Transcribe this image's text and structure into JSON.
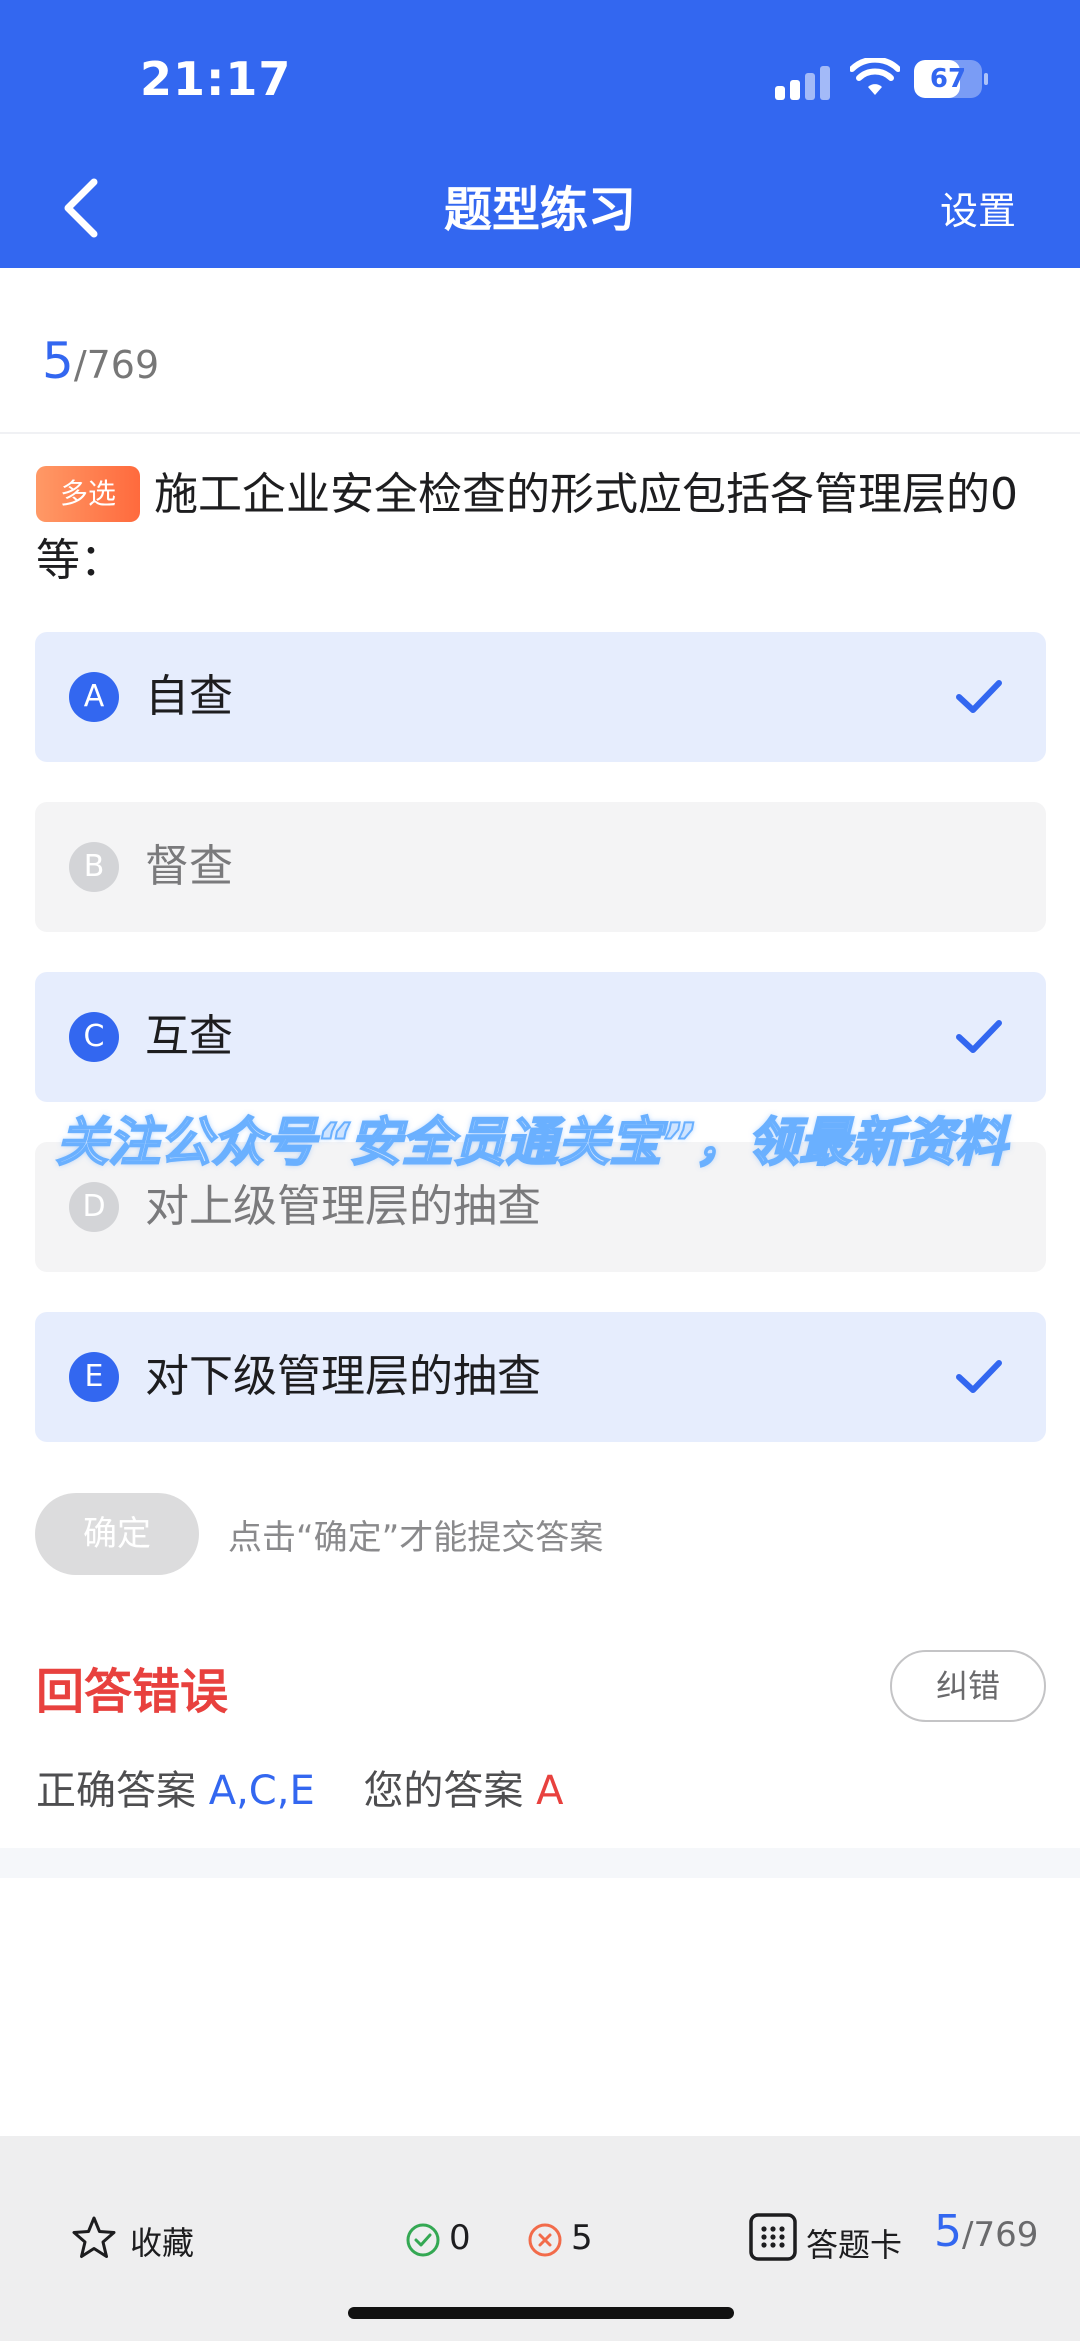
{
  "status_bar": {
    "time": "21:17",
    "battery": "67",
    "battery_level": 0.67
  },
  "header": {
    "title": "题型练习",
    "settings_label": "设置",
    "back_icon": "chevron-left-icon"
  },
  "progress": {
    "current": "5",
    "total": "/769"
  },
  "question": {
    "type_tag": "多选",
    "text": "施工企业安全检查的形式应包括各管理层的0等："
  },
  "options": [
    {
      "letter": "A",
      "text": "自查",
      "selected": true
    },
    {
      "letter": "B",
      "text": "督查",
      "selected": false
    },
    {
      "letter": "C",
      "text": "互查",
      "selected": true
    },
    {
      "letter": "D",
      "text": "对上级管理层的抽查",
      "selected": false
    },
    {
      "letter": "E",
      "text": "对下级管理层的抽查",
      "selected": true
    }
  ],
  "watermark": "关注公众号“安全员通关宝”，领最新资料",
  "confirm": {
    "button_label": "确定",
    "hint": "点击“确定”才能提交答案"
  },
  "result": {
    "title": "回答错误",
    "report_label": "纠错",
    "correct_label": "正确答案",
    "correct_value": "A,C,E",
    "your_label": "您的答案",
    "your_value": "A"
  },
  "bottom_bar": {
    "favorite_label": "收藏",
    "correct_count": "0",
    "wrong_count": "5",
    "answer_card_label": "答题卡",
    "current": "5",
    "total": "/769"
  },
  "colors": {
    "primary": "#3367f0",
    "error": "#e8413e",
    "success": "#34a853",
    "tag": "#ff7a45"
  }
}
